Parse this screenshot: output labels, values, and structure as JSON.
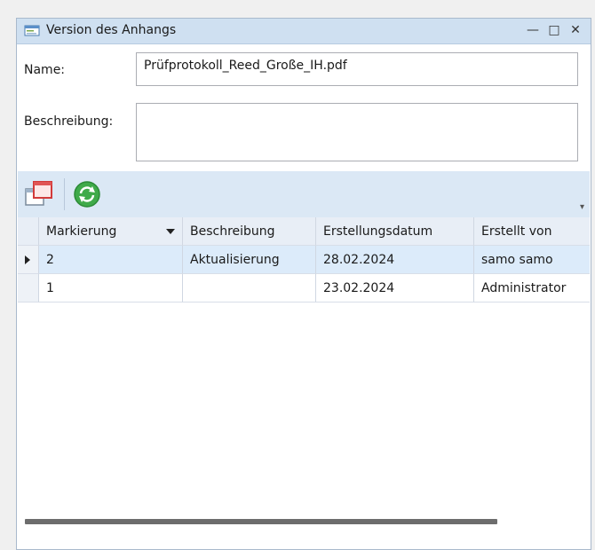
{
  "window": {
    "title": "Version des Anhangs",
    "minimize_glyph": "—",
    "maximize_glyph": "□",
    "close_glyph": "✕"
  },
  "form": {
    "name_label": "Name:",
    "name_value": "Prüfprotokoll_Reed_Große_IH.pdf",
    "description_label": "Beschreibung:",
    "description_value": ""
  },
  "toolbar": {
    "icons": [
      "copy-windows-icon",
      "refresh-icon"
    ],
    "overflow_glyph": "▾"
  },
  "grid": {
    "columns": [
      "Markierung",
      "Beschreibung",
      "Erstellungsdatum",
      "Erstellt von"
    ],
    "sorted_column": "Markierung",
    "rows": [
      {
        "markierung": "2",
        "beschreibung": "Aktualisierung",
        "datum": "28.02.2024",
        "von": "samo samo",
        "selected": true
      },
      {
        "markierung": "1",
        "beschreibung": "",
        "datum": "23.02.2024",
        "von": "Administrator",
        "selected": false
      }
    ]
  },
  "colors": {
    "titlebar": "#cfe0f1",
    "toolbar": "#dbe8f5",
    "selected_row": "#dcebfa"
  }
}
